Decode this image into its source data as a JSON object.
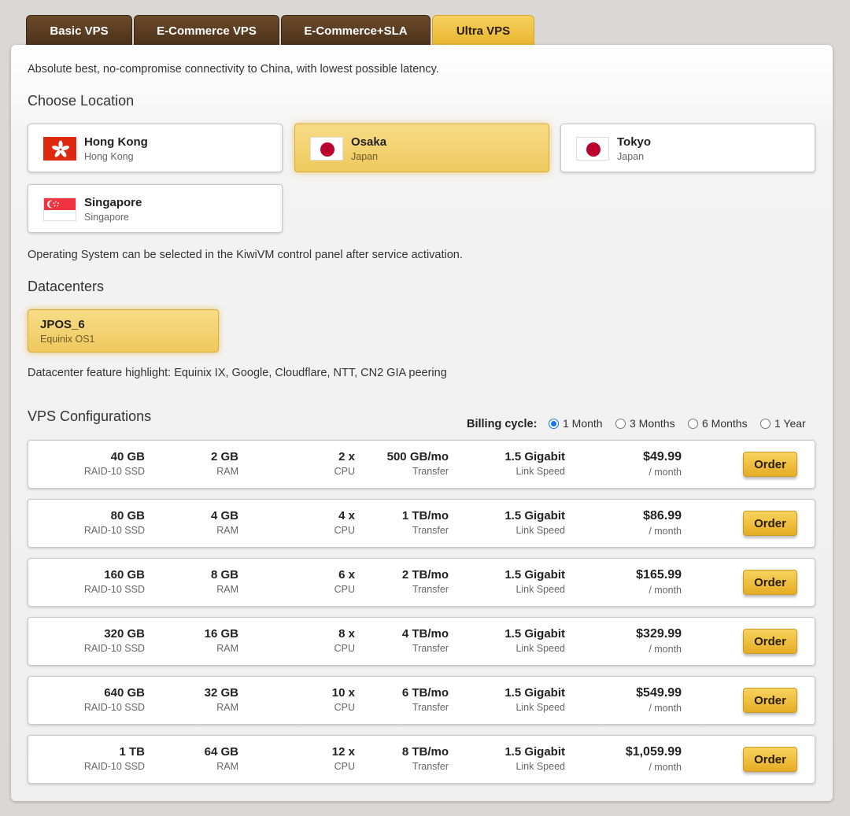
{
  "tabs": [
    {
      "label": "Basic VPS",
      "active": false
    },
    {
      "label": "E-Commerce VPS",
      "active": false
    },
    {
      "label": "E-Commerce+SLA",
      "active": false
    },
    {
      "label": "Ultra VPS",
      "active": true
    }
  ],
  "intro": "Absolute best, no-compromise connectivity to China, with lowest possible latency.",
  "location_title": "Choose Location",
  "locations": [
    {
      "name": "Hong Kong",
      "country": "Hong Kong",
      "flag": "hong-kong-flag-icon",
      "selected": false
    },
    {
      "name": "Osaka",
      "country": "Japan",
      "flag": "japan-flag-icon",
      "selected": true
    },
    {
      "name": "Tokyo",
      "country": "Japan",
      "flag": "japan-flag-icon",
      "selected": false
    },
    {
      "name": "Singapore",
      "country": "Singapore",
      "flag": "singapore-flag-icon",
      "selected": false
    }
  ],
  "os_note": "Operating System can be selected in the KiwiVM control panel after service activation.",
  "datacenters_title": "Datacenters",
  "datacenter": {
    "name": "JPOS_6",
    "sub": "Equinix OS1"
  },
  "dc_feature": "Datacenter feature highlight: Equinix IX, Google, Cloudflare, NTT, CN2 GIA peering",
  "configs_title": "VPS Configurations",
  "billing": {
    "label": "Billing cycle:",
    "options": [
      {
        "label": "1 Month",
        "selected": true
      },
      {
        "label": "3 Months",
        "selected": false
      },
      {
        "label": "6 Months",
        "selected": false
      },
      {
        "label": "1 Year",
        "selected": false
      }
    ]
  },
  "labels": {
    "disk": "RAID-10 SSD",
    "ram": "RAM",
    "cpu": "CPU",
    "transfer": "Transfer",
    "link": "Link Speed",
    "per": "/ month",
    "order": "Order"
  },
  "configs": [
    {
      "disk": "40 GB",
      "ram": "2 GB",
      "cpu": "2 x",
      "transfer": "500 GB/mo",
      "link": "1.5 Gigabit",
      "price": "$49.99"
    },
    {
      "disk": "80 GB",
      "ram": "4 GB",
      "cpu": "4 x",
      "transfer": "1 TB/mo",
      "link": "1.5 Gigabit",
      "price": "$86.99"
    },
    {
      "disk": "160 GB",
      "ram": "8 GB",
      "cpu": "6 x",
      "transfer": "2 TB/mo",
      "link": "1.5 Gigabit",
      "price": "$165.99"
    },
    {
      "disk": "320 GB",
      "ram": "16 GB",
      "cpu": "8 x",
      "transfer": "4 TB/mo",
      "link": "1.5 Gigabit",
      "price": "$329.99"
    },
    {
      "disk": "640 GB",
      "ram": "32 GB",
      "cpu": "10 x",
      "transfer": "6 TB/mo",
      "link": "1.5 Gigabit",
      "price": "$549.99"
    },
    {
      "disk": "1 TB",
      "ram": "64 GB",
      "cpu": "12 x",
      "transfer": "8 TB/mo",
      "link": "1.5 Gigabit",
      "price": "$1,059.99"
    }
  ]
}
